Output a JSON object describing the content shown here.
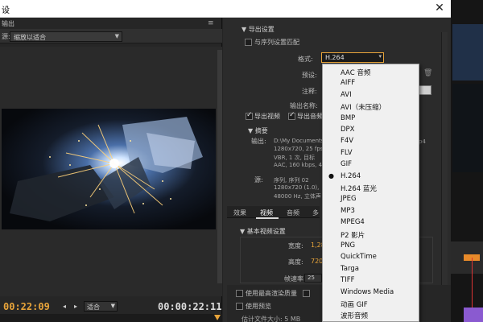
{
  "window": {
    "title": "设",
    "close_glyph": "✕"
  },
  "left_panel": {
    "tab_label": "输出",
    "close_glyph": "≡",
    "source_label": "源:",
    "source_scaling": "缩放以适合",
    "timecode_in": "00:22:09",
    "timecode_out": "00:00:22:11",
    "fit_label": "适合",
    "mark_in_glyph": "◂",
    "mark_out_glyph": "▸"
  },
  "export_settings": {
    "section_label": "导出设置",
    "match_sequence_label": "与序列设置匹配",
    "format_label": "格式:",
    "format_value": "H.264",
    "preset_label": "预设:",
    "comment_label": "注释:",
    "output_name_label": "输出名称:",
    "export_video_label": "导出视频",
    "export_video_checked": true,
    "export_audio_label": "导出音频",
    "export_audio_checked": true
  },
  "summary": {
    "section_label": "摘要",
    "output_label": "输出:",
    "output_path": "D:\\My Documents",
    "output_line2": "1280x720, 25 fps",
    "output_line3": "VBR, 1 次, 目标",
    "output_line4": "AAC, 160 kbps, 4",
    "output_right": "p4",
    "source_label": "源:",
    "source_line1": "序列, 序列 02",
    "source_line2": "1280x720 (1.0),",
    "source_line3": "48000 Hz, 立体声"
  },
  "tabs": {
    "items": [
      {
        "label": "效果",
        "active": false
      },
      {
        "label": "视频",
        "active": true
      },
      {
        "label": "音频",
        "active": false
      },
      {
        "label": "多",
        "active": false
      }
    ]
  },
  "basic_video": {
    "section_label": "基本视频设置",
    "width_label": "宽度:",
    "width_value": "1,28",
    "height_label": "高度:",
    "height_value": "720",
    "frame_rate_label": "帧速率:",
    "frame_rate_value": "25"
  },
  "bottom": {
    "max_quality_label": "使用最高渲染质量",
    "preview_label": "使用预览",
    "file_size_label": "估计文件大小: 5 MB"
  },
  "format_dropdown": {
    "selected": "H.264",
    "items": [
      "AAC 音频",
      "AIFF",
      "AVI",
      "AVI（未压缩）",
      "BMP",
      "DPX",
      "F4V",
      "FLV",
      "GIF",
      "H.264",
      "H.264 蓝光",
      "JPEG",
      "MP3",
      "MPEG4",
      "P2 影片",
      "PNG",
      "QuickTime",
      "Targa",
      "TIFF",
      "Windows Media",
      "动画 GIF",
      "波形音频"
    ]
  },
  "colors": {
    "accent_orange": "#e8a43a",
    "panel_dark": "#262626",
    "dropdown_bg": "#f0f0f0"
  }
}
